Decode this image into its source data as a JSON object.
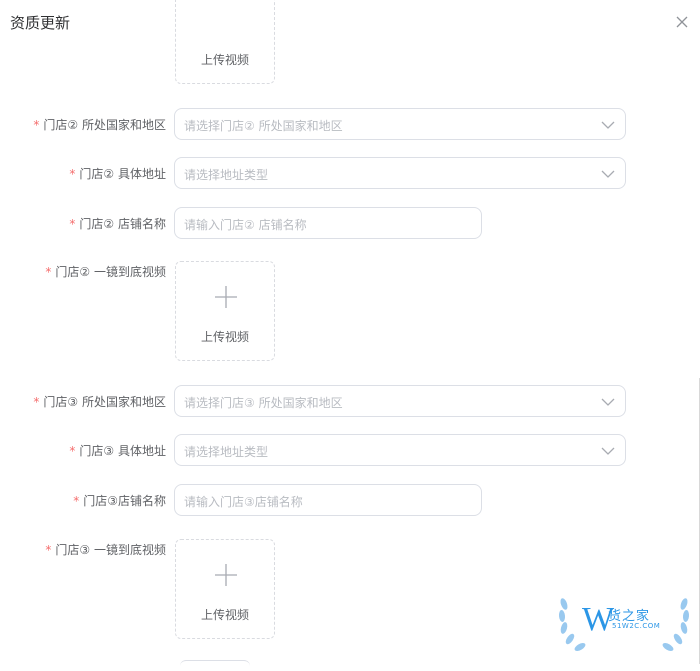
{
  "dialog": {
    "title": "资质更新"
  },
  "upload_label": "上传视频",
  "store2": {
    "country_label": "门店② 所处国家和地区",
    "country_placeholder": "请选择门店② 所处国家和地区",
    "address_label": "门店② 具体地址",
    "address_placeholder": "请选择地址类型",
    "name_label": "门店② 店铺名称",
    "name_placeholder": "请输入门店② 店铺名称",
    "video_label": "门店② 一镜到底视频"
  },
  "store3": {
    "country_label": "门店③ 所处国家和地区",
    "country_placeholder": "请选择门店③ 所处国家和地区",
    "address_label": "门店③ 具体地址",
    "address_placeholder": "请选择地址类型",
    "name_label": "门店③店铺名称",
    "name_placeholder": "请输入门店③店铺名称",
    "video_label": "门店③ 一镜到底视频"
  },
  "required_mark": "*",
  "watermark": {
    "brand": "货之家",
    "domain": "51W2C.COM",
    "letter": "W"
  },
  "colors": {
    "required": "#f56c6c",
    "border": "#dcdfe6",
    "placeholder": "#b9bcc2",
    "text": "#606266",
    "watermark": "#2b96e6"
  },
  "icons": {
    "close": "close-icon",
    "chevron": "chevron-down-icon",
    "plus": "plus-icon"
  }
}
